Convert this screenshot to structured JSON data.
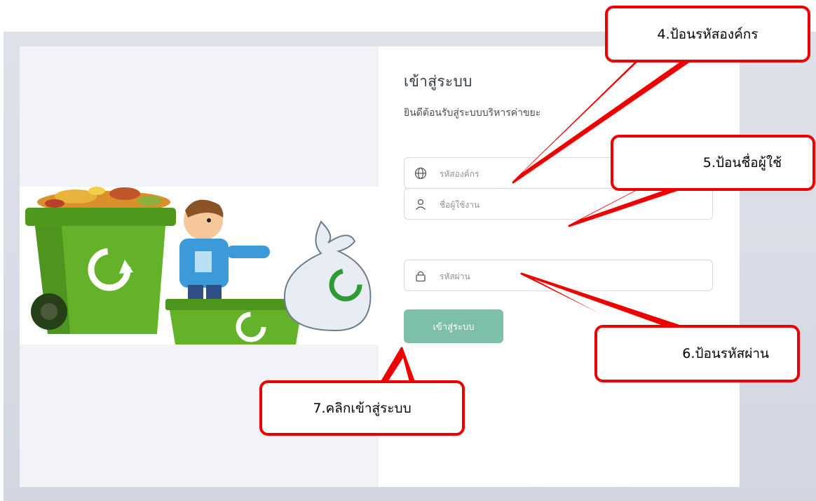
{
  "login": {
    "title": "เข้าสู่ระบบ",
    "subtitle": "ยินดีต้อนรับสู่ระบบบริหารค่าขยะ",
    "org_placeholder": "รหัสองค์กร",
    "username_placeholder": "ชื่อผู้ใช้งาน",
    "password_placeholder": "รหัสผ่าน",
    "button_label": "เข้าสู่ระบบ",
    "button_color": "#7ebfab"
  },
  "icons": {
    "org": "globe-icon",
    "username": "user-icon",
    "password": "lock-icon"
  },
  "callouts": {
    "step4": "4.ป้อนรหัสองค์กร",
    "step5": "5.ป้อนชื่อผู้ใช้",
    "step6": "6.ป้อนรหัสผ่าน",
    "step7": "7.คลิกเข้าสู่ระบบ",
    "color": "#ee0000"
  }
}
